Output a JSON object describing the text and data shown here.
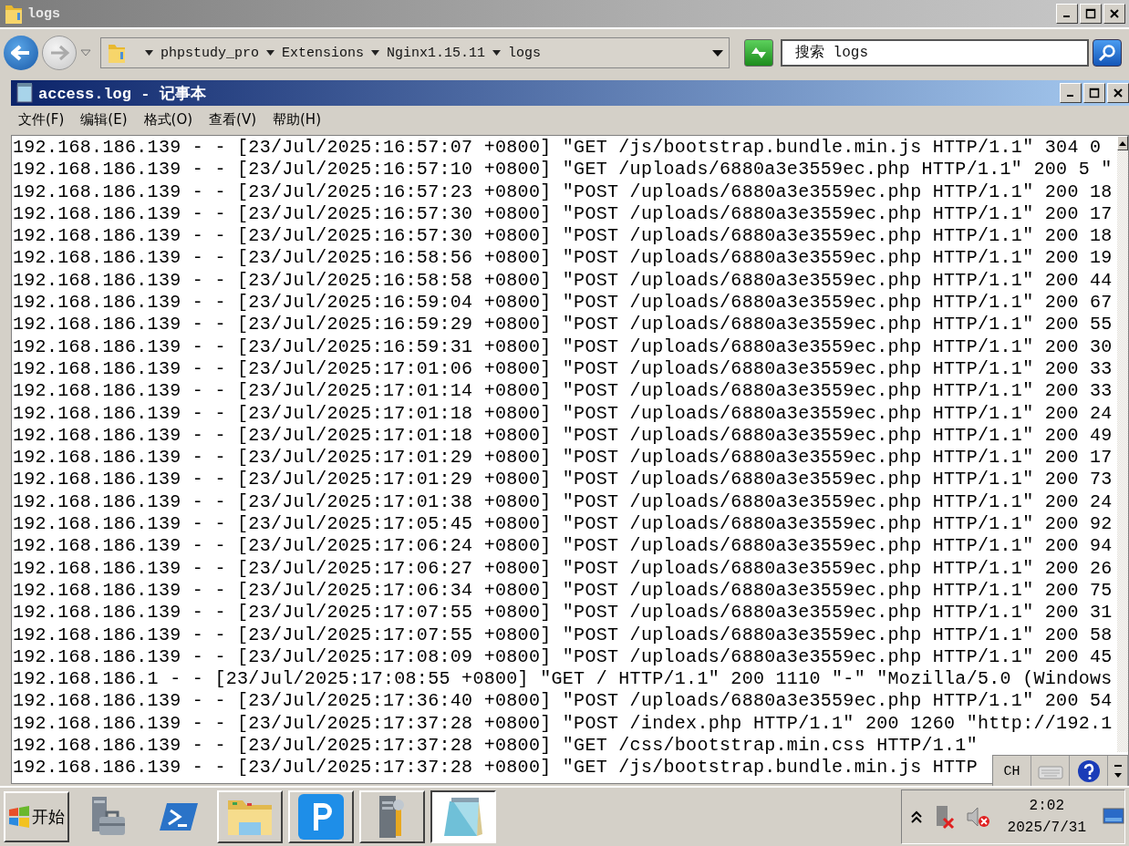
{
  "explorer": {
    "title": "logs",
    "breadcrumb": [
      "phpstudy_pro",
      "Extensions",
      "Nginx1.15.11",
      "logs"
    ],
    "search": {
      "placeholder": "搜索 logs"
    }
  },
  "notepad": {
    "title": "access.log - 记事本",
    "menu": [
      "文件(F)",
      "编辑(E)",
      "格式(O)",
      "查看(V)",
      "帮助(H)"
    ],
    "lines": [
      "192.168.186.139 - - [23/Jul/2025:16:57:07 +0800] \"GET /js/bootstrap.bundle.min.js HTTP/1.1\" 304 0",
      "192.168.186.139 - - [23/Jul/2025:16:57:10 +0800] \"GET /uploads/6880a3e3559ec.php HTTP/1.1\" 200 5 \"",
      "192.168.186.139 - - [23/Jul/2025:16:57:23 +0800] \"POST /uploads/6880a3e3559ec.php HTTP/1.1\" 200 18",
      "192.168.186.139 - - [23/Jul/2025:16:57:30 +0800] \"POST /uploads/6880a3e3559ec.php HTTP/1.1\" 200 17",
      "192.168.186.139 - - [23/Jul/2025:16:57:30 +0800] \"POST /uploads/6880a3e3559ec.php HTTP/1.1\" 200 18",
      "192.168.186.139 - - [23/Jul/2025:16:58:56 +0800] \"POST /uploads/6880a3e3559ec.php HTTP/1.1\" 200 19",
      "192.168.186.139 - - [23/Jul/2025:16:58:58 +0800] \"POST /uploads/6880a3e3559ec.php HTTP/1.1\" 200 44",
      "192.168.186.139 - - [23/Jul/2025:16:59:04 +0800] \"POST /uploads/6880a3e3559ec.php HTTP/1.1\" 200 67",
      "192.168.186.139 - - [23/Jul/2025:16:59:29 +0800] \"POST /uploads/6880a3e3559ec.php HTTP/1.1\" 200 55",
      "192.168.186.139 - - [23/Jul/2025:16:59:31 +0800] \"POST /uploads/6880a3e3559ec.php HTTP/1.1\" 200 30",
      "192.168.186.139 - - [23/Jul/2025:17:01:06 +0800] \"POST /uploads/6880a3e3559ec.php HTTP/1.1\" 200 33",
      "192.168.186.139 - - [23/Jul/2025:17:01:14 +0800] \"POST /uploads/6880a3e3559ec.php HTTP/1.1\" 200 33",
      "192.168.186.139 - - [23/Jul/2025:17:01:18 +0800] \"POST /uploads/6880a3e3559ec.php HTTP/1.1\" 200 24",
      "192.168.186.139 - - [23/Jul/2025:17:01:18 +0800] \"POST /uploads/6880a3e3559ec.php HTTP/1.1\" 200 49",
      "192.168.186.139 - - [23/Jul/2025:17:01:29 +0800] \"POST /uploads/6880a3e3559ec.php HTTP/1.1\" 200 17",
      "192.168.186.139 - - [23/Jul/2025:17:01:29 +0800] \"POST /uploads/6880a3e3559ec.php HTTP/1.1\" 200 73",
      "192.168.186.139 - - [23/Jul/2025:17:01:38 +0800] \"POST /uploads/6880a3e3559ec.php HTTP/1.1\" 200 24",
      "192.168.186.139 - - [23/Jul/2025:17:05:45 +0800] \"POST /uploads/6880a3e3559ec.php HTTP/1.1\" 200 92",
      "192.168.186.139 - - [23/Jul/2025:17:06:24 +0800] \"POST /uploads/6880a3e3559ec.php HTTP/1.1\" 200 94",
      "192.168.186.139 - - [23/Jul/2025:17:06:27 +0800] \"POST /uploads/6880a3e3559ec.php HTTP/1.1\" 200 26",
      "192.168.186.139 - - [23/Jul/2025:17:06:34 +0800] \"POST /uploads/6880a3e3559ec.php HTTP/1.1\" 200 75",
      "192.168.186.139 - - [23/Jul/2025:17:07:55 +0800] \"POST /uploads/6880a3e3559ec.php HTTP/1.1\" 200 31",
      "192.168.186.139 - - [23/Jul/2025:17:07:55 +0800] \"POST /uploads/6880a3e3559ec.php HTTP/1.1\" 200 58",
      "192.168.186.139 - - [23/Jul/2025:17:08:09 +0800] \"POST /uploads/6880a3e3559ec.php HTTP/1.1\" 200 45",
      "192.168.186.1 - - [23/Jul/2025:17:08:55 +0800] \"GET / HTTP/1.1\" 200 1110 \"-\" \"Mozilla/5.0 (Windows",
      "192.168.186.139 - - [23/Jul/2025:17:36:40 +0800] \"POST /uploads/6880a3e3559ec.php HTTP/1.1\" 200 54",
      "192.168.186.139 - - [23/Jul/2025:17:37:28 +0800] \"POST /index.php HTTP/1.1\" 200 1260 \"http://192.1",
      "192.168.186.139 - - [23/Jul/2025:17:37:28 +0800] \"GET /css/bootstrap.min.css HTTP/1.1\"",
      "192.168.186.139 - - [23/Jul/2025:17:37:28 +0800] \"GET /js/bootstrap.bundle.min.js HTTP"
    ]
  },
  "language_bar": {
    "label": "CH"
  },
  "taskbar": {
    "start": "开始",
    "apps": [
      {
        "kind": "server-toolbox",
        "running": false,
        "selected": false
      },
      {
        "kind": "powershell",
        "running": false,
        "selected": false
      },
      {
        "kind": "folder",
        "running": true,
        "selected": false
      },
      {
        "kind": "p-app",
        "running": true,
        "selected": false
      },
      {
        "kind": "server-wrench",
        "running": true,
        "selected": false
      },
      {
        "kind": "notepad",
        "running": true,
        "selected": true
      }
    ],
    "clock": {
      "time": "2:02",
      "date": "2025/7/31"
    }
  }
}
